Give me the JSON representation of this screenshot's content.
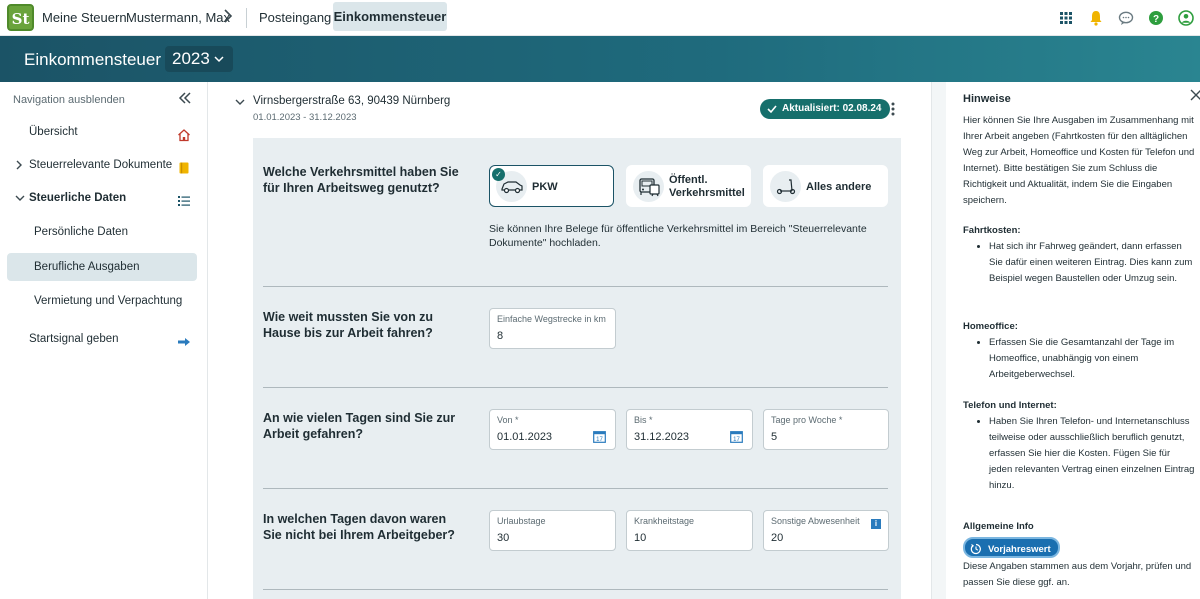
{
  "topbar": {
    "logo_text": "St",
    "links": [
      "Meine Steuern",
      "Mustermann, Max",
      "Posteingang"
    ],
    "active_tab": "Einkommensteuer",
    "icons": [
      "apps-grid-icon",
      "bell-icon",
      "chat-icon",
      "help-icon",
      "user-icon"
    ]
  },
  "header": {
    "title": "Einkommensteuer",
    "year": "2023"
  },
  "sidebar": {
    "hide_label": "Navigation ausblenden",
    "items": [
      {
        "label": "Übersicht"
      },
      {
        "label": "Steuerrelevante Dokumente"
      },
      {
        "label": "Steuerliche Daten"
      },
      {
        "label": "Persönliche Daten"
      },
      {
        "label": "Berufliche Ausgaben"
      },
      {
        "label": "Vermietung und Verpachtung"
      },
      {
        "label": "Startsignal geben"
      }
    ]
  },
  "main": {
    "address": "Virnsbergerstraße 63, 90439 Nürnberg",
    "period": "01.01.2023 - 31.12.2023",
    "status": "Aktualisiert: 02.08.24",
    "q1": {
      "label": "Welche Verkehrsmittel haben Sie für Ihren Arbeitsweg genutzt?",
      "options": [
        "PKW",
        "Öffentl. Verkehrsmittel",
        "Alles andere"
      ],
      "hint": "Sie können Ihre Belege für öffentliche Verkehrsmittel im Bereich \"Steuerrelevante Dokumente\" hochladen."
    },
    "q2": {
      "label": "Wie weit mussten Sie von zu Hause bis zur Arbeit fahren?",
      "field_label": "Einfache Wegstrecke in km",
      "field_value": "8"
    },
    "q3": {
      "label": "An wie vielen Tagen sind Sie zur Arbeit gefahren?",
      "from_label": "Von *",
      "from_value": "01.01.2023",
      "to_label": "Bis *",
      "to_value": "31.12.2023",
      "days_label": "Tage pro Woche *",
      "days_value": "5"
    },
    "q4": {
      "label": "In welchen Tagen davon waren Sie nicht bei Ihrem Arbeitgeber?",
      "vac_label": "Urlaubstage",
      "vac_value": "30",
      "sick_label": "Krankheitstage",
      "sick_value": "10",
      "other_label": "Sonstige Abwesenheit",
      "other_value": "20"
    }
  },
  "hints": {
    "title": "Hinweise",
    "intro": "Hier können Sie Ihre Ausgaben im Zusammenhang mit Ihrer Arbeit angeben (Fahrtkosten für den alltäglichen Weg zur Arbeit, Homeoffice und Kosten für Telefon und Internet). Bitte bestätigen Sie zum Schluss die Richtigkeit und Aktualität, indem Sie die Eingaben speichern.",
    "fahrt_head": "Fahrtkosten:",
    "fahrt_item": "Hat sich ihr Fahrweg geändert, dann erfassen Sie dafür einen weiteren Eintrag. Dies kann zum Beispiel wegen Baustellen oder Umzug sein.",
    "home_head": "Homeoffice:",
    "home_item": "Erfassen Sie die Gesamtanzahl der Tage im Homeoffice, unabhängig von einem Arbeitgeberwechsel.",
    "tel_head": "Telefon und Internet:",
    "tel_item": "Haben Sie Ihren Telefon- und Internetanschluss teilweise oder ausschließlich beruflich genutzt, erfassen Sie hier die Kosten. Fügen Sie für jeden relevanten Vertrag einen einzelnen Eintrag hinzu.",
    "info_head": "Allgemeine Info",
    "prev_badge": "Vorjahreswert",
    "prev_text": "Diese Angaben stammen aus dem Vorjahr, prüfen und passen Sie diese ggf. an."
  }
}
